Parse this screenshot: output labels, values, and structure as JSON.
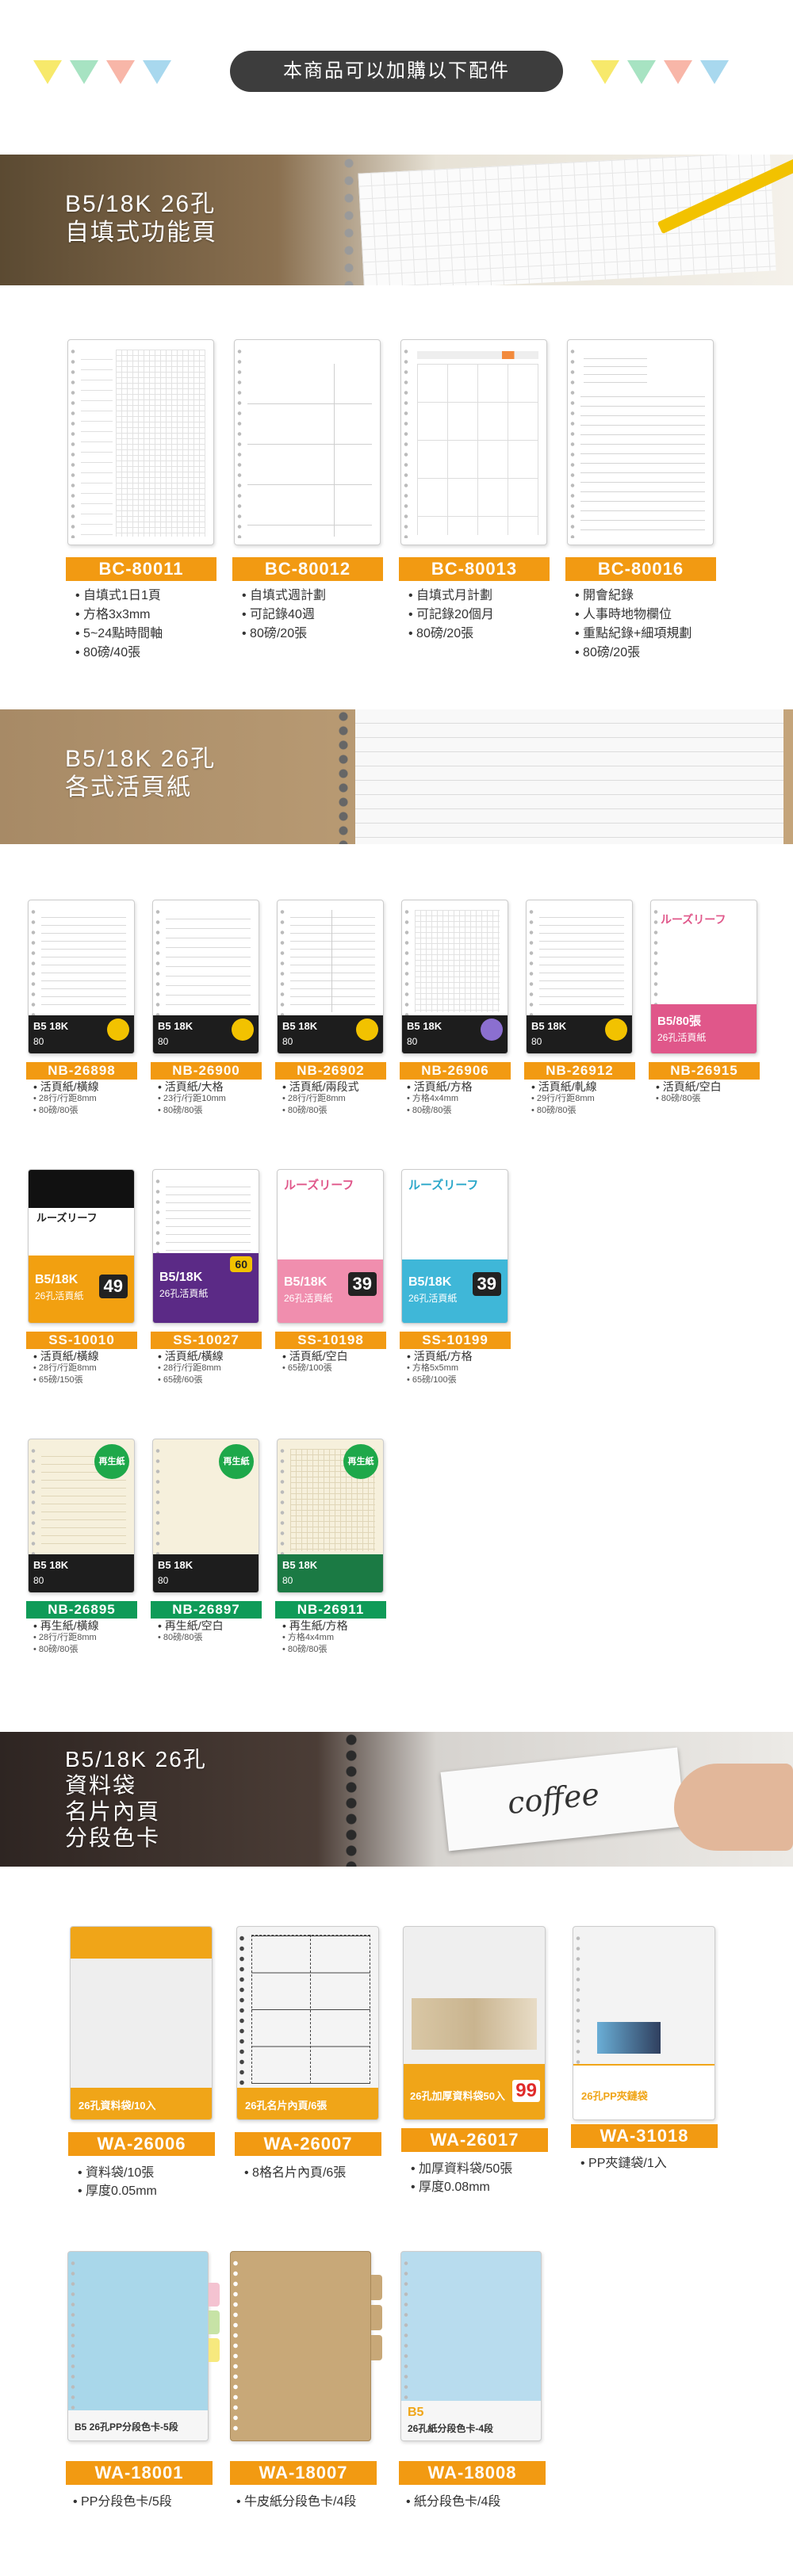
{
  "header": {
    "title": "本商品可以加購以下配件",
    "triangle_colors": [
      "#f7e96b",
      "#a7e3c2",
      "#f8b6a8",
      "#a8d8ee"
    ]
  },
  "section1": {
    "banner_title_line1": "B5/18K 26孔",
    "banner_title_line2": "自填式功能頁",
    "items": [
      {
        "code": "BC-80011",
        "lines": [
          "自填式1日1頁",
          "方格3x3mm",
          "5~24點時間軸",
          "80磅/40張"
        ]
      },
      {
        "code": "BC-80012",
        "lines": [
          "自填式週計劃",
          "可記錄40週",
          "80磅/20張"
        ]
      },
      {
        "code": "BC-80013",
        "lines": [
          "自填式月計劃",
          "可記錄20個月",
          "80磅/20張"
        ]
      },
      {
        "code": "BC-80016",
        "lines": [
          "開會紀錄",
          "人事時地物欄位",
          "重點紀錄+細項規劃",
          "80磅/20張"
        ]
      }
    ]
  },
  "section2": {
    "banner_title_line1": "B5/18K 26孔",
    "banner_title_line2": "各式活頁紙",
    "row1": [
      {
        "code": "NB-26898",
        "title": "活頁紙/橫線",
        "sub": [
          "28行/行距8mm",
          "80磅/80張"
        ]
      },
      {
        "code": "NB-26900",
        "title": "活頁紙/大格",
        "sub": [
          "23行/行距10mm",
          "80磅/80張"
        ]
      },
      {
        "code": "NB-26902",
        "title": "活頁紙/兩段式",
        "sub": [
          "28行/行距8mm",
          "80磅/80張"
        ]
      },
      {
        "code": "NB-26906",
        "title": "活頁紙/方格",
        "sub": [
          "方格4x4mm",
          "80磅/80張"
        ]
      },
      {
        "code": "NB-26912",
        "title": "活頁紙/軋線",
        "sub": [
          "29行/行距8mm",
          "80磅/80張"
        ]
      },
      {
        "code": "NB-26915",
        "title": "活頁紙/空白",
        "sub": [
          "80磅/80張"
        ]
      }
    ],
    "row2": [
      {
        "code": "SS-10010",
        "title": "活頁紙/橫線",
        "sub": [
          "28行/行距8mm",
          "65磅/150張"
        ],
        "badge": "49"
      },
      {
        "code": "SS-10027",
        "title": "活頁紙/橫線",
        "sub": [
          "28行/行距8mm",
          "65磅/60張"
        ],
        "badge": "60"
      },
      {
        "code": "SS-10198",
        "title": "活頁紙/空白",
        "sub": [
          "65磅/100張"
        ],
        "badge": "39"
      },
      {
        "code": "SS-10199",
        "title": "活頁紙/方格",
        "sub": [
          "方格5x5mm",
          "65磅/100張"
        ],
        "badge": "39"
      }
    ],
    "row3": [
      {
        "code": "NB-26895",
        "title": "再生紙/橫線",
        "sub": [
          "28行/行距8mm",
          "80磅/80張"
        ]
      },
      {
        "code": "NB-26897",
        "title": "再生紙/空白",
        "sub": [
          "80磅/80張"
        ]
      },
      {
        "code": "NB-26911",
        "title": "再生紙/方格",
        "sub": [
          "方格4x4mm",
          "80磅/80張"
        ]
      }
    ],
    "recycle_label": "再生紙",
    "cover_text": "B5 18K",
    "cover_sub": "80",
    "pink_cover": {
      "header": "ルーズリーフ",
      "big": "B5/80張",
      "small": "26孔活頁紙",
      "count": "80張"
    },
    "ss_cover": {
      "header": "ルーズリーフ",
      "big": "B5/18K",
      "small": "26孔活頁紙"
    }
  },
  "section3": {
    "banner_title_line1": "B5/18K 26孔",
    "banner_title_line2": "資料袋",
    "banner_title_line3": "名片內頁",
    "banner_title_line4": "分段色卡",
    "banner_script": "coffee",
    "row1": [
      {
        "code": "WA-26006",
        "lines": [
          "資料袋/10張",
          "厚度0.05mm"
        ]
      },
      {
        "code": "WA-26007",
        "lines": [
          "8格名片內頁/6張"
        ]
      },
      {
        "code": "WA-26017",
        "lines": [
          "加厚資料袋/50張",
          "厚度0.08mm"
        ]
      },
      {
        "code": "WA-31018",
        "lines": [
          "PP夾鏈袋/1入"
        ]
      }
    ],
    "row2": [
      {
        "code": "WA-18001",
        "lines": [
          "PP分段色卡/5段"
        ]
      },
      {
        "code": "WA-18007",
        "lines": [
          "牛皮紙分段色卡/4段"
        ]
      },
      {
        "code": "WA-18008",
        "lines": [
          "紙分段色卡/4段"
        ]
      }
    ],
    "pack_labels": {
      "a": "26孔資料袋/10入",
      "b": "26孔名片內頁/6張",
      "c": "26孔加厚資料袋50入",
      "c_price": "99",
      "d": "26孔PP夾鏈袋",
      "e": "B5 26孔PP分段色卡-5段",
      "f": "B5",
      "g": "26孔紙分段色卡-4段"
    }
  }
}
